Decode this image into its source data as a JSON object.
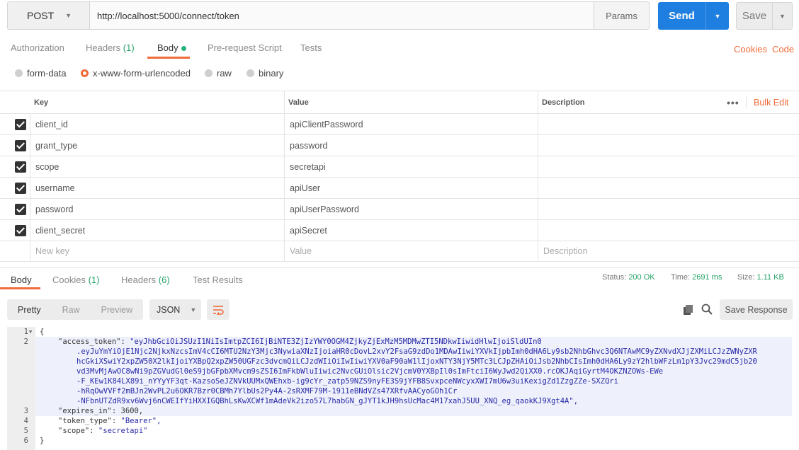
{
  "request": {
    "method": "POST",
    "url": "http://localhost:5000/connect/token",
    "params_label": "Params",
    "send_label": "Send",
    "save_label": "Save"
  },
  "request_tabs": [
    {
      "label": "Authorization"
    },
    {
      "label": "Headers",
      "count": "(1)"
    },
    {
      "label": "Body"
    },
    {
      "label": "Pre-request Script"
    },
    {
      "label": "Tests"
    }
  ],
  "right_links": {
    "cookies": "Cookies",
    "code": "Code"
  },
  "body_types": [
    "form-data",
    "x-www-form-urlencoded",
    "raw",
    "binary"
  ],
  "selected_body_type": "x-www-form-urlencoded",
  "params_table": {
    "headers": {
      "key": "Key",
      "value": "Value",
      "description": "Description",
      "bulk_edit": "Bulk Edit",
      "more": "•••"
    },
    "rows": [
      {
        "key": "client_id",
        "value": "apiClientPassword",
        "checked": true
      },
      {
        "key": "grant_type",
        "value": "password",
        "checked": true
      },
      {
        "key": "scope",
        "value": "secretapi",
        "checked": true
      },
      {
        "key": "username",
        "value": "apiUser",
        "checked": true
      },
      {
        "key": "password",
        "value": "apiUserPassword",
        "checked": true
      },
      {
        "key": "client_secret",
        "value": "apiSecret",
        "checked": true
      }
    ],
    "new_row": {
      "key": "New key",
      "value": "Value",
      "description": "Description"
    }
  },
  "response_tabs": [
    {
      "label": "Body"
    },
    {
      "label": "Cookies",
      "count": "(1)"
    },
    {
      "label": "Headers",
      "count": "(6)"
    },
    {
      "label": "Test Results"
    }
  ],
  "response_status": {
    "status_label": "Status:",
    "status_value": "200 OK",
    "time_label": "Time:",
    "time_value": "2691 ms",
    "size_label": "Size:",
    "size_value": "1.11 KB"
  },
  "response_toolbar": {
    "pretty": "Pretty",
    "raw": "Raw",
    "preview": "Preview",
    "format": "JSON",
    "save_response": "Save Response"
  },
  "response_body": {
    "line_numbers": [
      "1",
      "2",
      "3",
      "4",
      "5",
      "6"
    ],
    "open_brace": "{",
    "close_brace": "}",
    "access_token_key": "\"access_token\"",
    "access_token_lines": [
      "\"eyJhbGciOiJSUzI1NiIsImtpZCI6IjBiNTE3ZjIzYWY0OGM4ZjkyZjExMzM5MDMwZTI5NDkwIiwidHlwIjoiSldUIn0",
      ".eyJuYmYiOjE1Njc2NjkxNzcsImV4cCI6MTU2NzY3Mjc3NywiaXNzIjoiaHR0cDovL2xvY2FsaG9zdDo1MDAwIiwiYXVkIjpbImh0dHA6Ly9sb2NhbGhvc3Q6NTAwMC9yZXNvdXJjZXMiLCJzZWNyZXR",
      "hcGkiXSwiY2xpZW50X2lkIjoiYXBpQ2xpZW50UGFzc3dvcmQiLCJzdWIiOiIwIiwiYXV0aF90aW1lIjoxNTY3NjY5MTc3LCJpZHAiOiJsb2NhbCIsImh0dHA6Ly9zY2hlbWFzLm1pY3Jvc29mdC5jb20",
      "vd3MvMjAwOC8wNi9pZGVudGl0eS9jbGFpbXMvcm9sZSI6ImFkbWluIiwic2NvcGUiOlsic2VjcmV0YXBpIl0sImFtciI6WyJwd2QiXX0.rcOKJAqiGyrtM4OKZNZOWs-EWe",
      "-F_KEw1K84LX89i_nYYyYF3qt-KazsoSeJZNVkUUMxQWEhxb-ig9cYr_zatp59NZS9nyFE3S9jYFB8SvxpceNWcyxXWI7mU6w3uiKexigZd1ZzgZZe-SXZQri",
      "-hRqOwVVFf2mBJn2WvPL2u6OKR7Bzr0CBMh7YlbUs2Py4A-2sRXMF79M-1911eBNdVZs47XRfvAACyoGOh1Cr",
      "-NFbnUTZdR9xv6Wvj6nCWEIfYiHXXIGQBhLsKwXCWf1mAdeVk2izo57L7habGN_gJYT1kJH9hsUcMac4M17xahJ5UU_XNQ_eg_qaokKJ9Xgt4A\","
    ],
    "expires_in_key": "\"expires_in\"",
    "expires_in_value": "3600,",
    "token_type_key": "\"token_type\"",
    "token_type_value": "\"Bearer\",",
    "scope_key": "\"scope\"",
    "scope_value": "\"secretapi\""
  },
  "colors": {
    "accent": "#f26b3a",
    "send": "#1e7fe0",
    "success": "#26a269"
  }
}
